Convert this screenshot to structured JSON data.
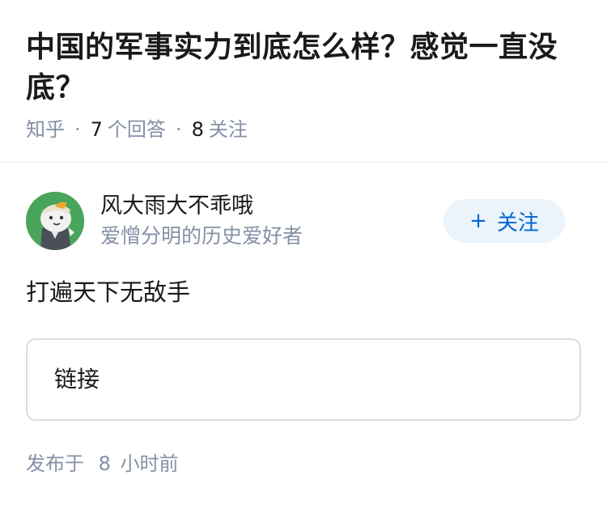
{
  "question": {
    "title": "中国的军事实力到底怎么样？感觉一直没底？",
    "source": "知乎",
    "answer_count": "7",
    "answer_label": "个回答",
    "follower_count": "8",
    "follower_label": "关注"
  },
  "answer": {
    "author": {
      "name": "风大雨大不乖哦",
      "bio": "爱憎分明的历史爱好者",
      "avatar_icon": "avatar-cartoon-icon",
      "follow_icon": "plus-icon",
      "follow_label": "关注"
    },
    "text": "打遍天下无敌手",
    "link_card_label": "链接",
    "publish_prefix": "发布于",
    "publish_value": "8",
    "publish_suffix": "小时前"
  },
  "colors": {
    "title": "#1a1a1a",
    "meta": "#8590a6",
    "follow_bg": "#ebf3fb",
    "follow_text": "#0066cc",
    "avatar_bg": "#49a55a"
  }
}
